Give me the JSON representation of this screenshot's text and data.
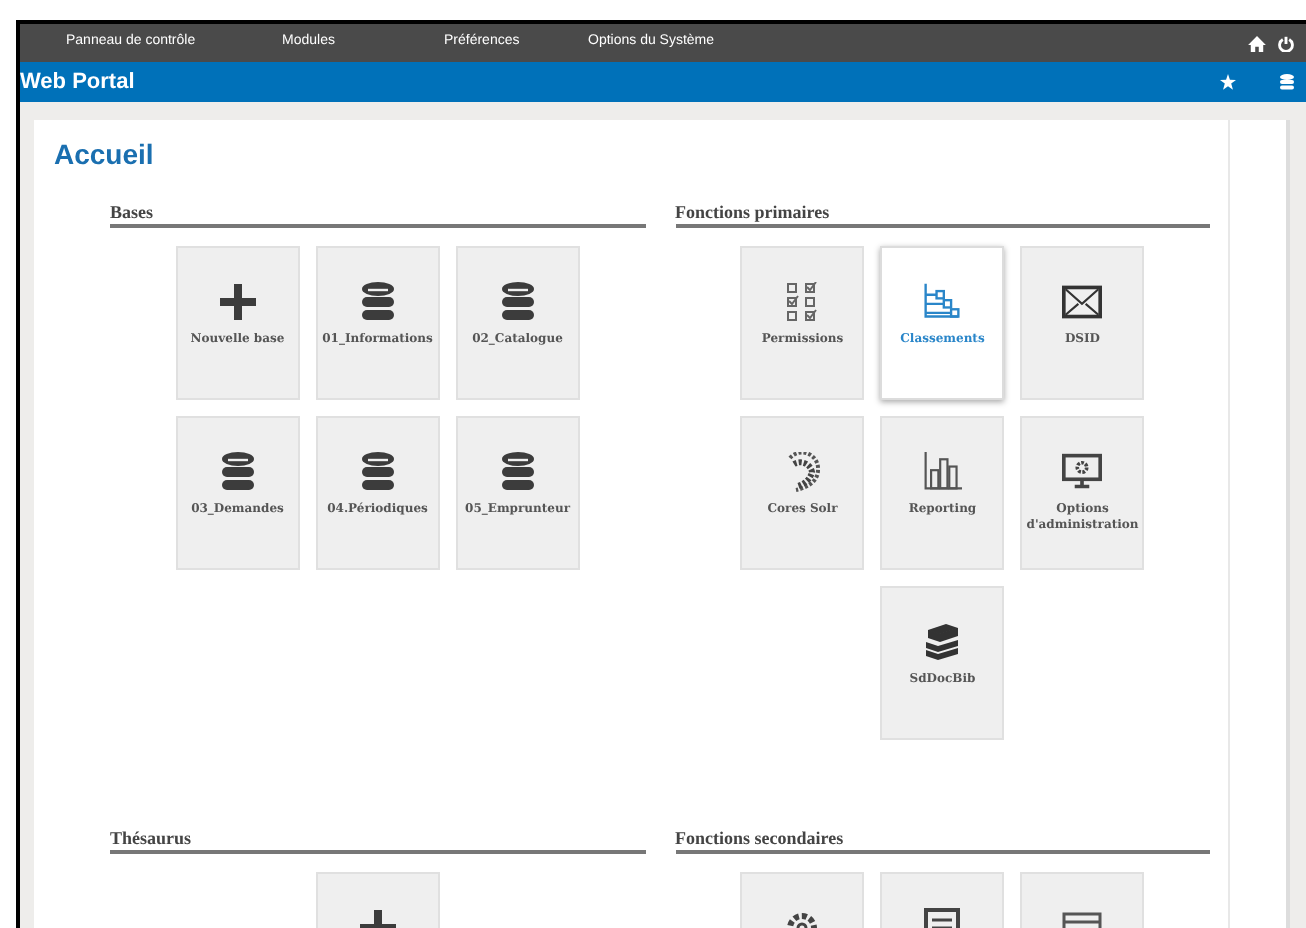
{
  "menu": [
    {
      "label": "Panneau de contrôle"
    },
    {
      "label": "Modules"
    },
    {
      "label": "Préférences"
    },
    {
      "label": "Options du Système"
    }
  ],
  "header": {
    "title": "Web Portal"
  },
  "page": {
    "title": "Accueil"
  },
  "sections": [
    {
      "title": "Bases",
      "tiles": [
        {
          "kind": "plus",
          "label": "Nouvelle base",
          "selected": false
        },
        {
          "kind": "database",
          "label": "01_Informations",
          "selected": false
        },
        {
          "kind": "database",
          "label": "02_Catalogue",
          "selected": false
        },
        {
          "kind": "database",
          "label": "03_Demandes",
          "selected": false
        },
        {
          "kind": "database",
          "label": "04.Périodiques",
          "selected": false
        },
        {
          "kind": "database",
          "label": "05_Emprunteur",
          "selected": false
        }
      ]
    },
    {
      "title": "Fonctions primaires",
      "tiles": [
        {
          "kind": "checklist",
          "label": "Permissions",
          "selected": false
        },
        {
          "kind": "tree",
          "label": "Classements",
          "selected": true
        },
        {
          "kind": "envelope",
          "label": "DSID",
          "selected": false
        },
        {
          "kind": "shell",
          "label": "Cores Solr",
          "selected": false
        },
        {
          "kind": "chart",
          "label": "Reporting",
          "selected": false
        },
        {
          "kind": "monitor",
          "label": "Options d'administration",
          "selected": false
        },
        {
          "kind": "books",
          "label": "SdDocBib",
          "selected": false
        }
      ]
    },
    {
      "title": "Thésaurus",
      "tiles": [
        {
          "kind": "plus",
          "selected": false
        }
      ]
    },
    {
      "title": "Fonctions secondaires",
      "tiles": [
        {
          "kind": "gear",
          "selected": false
        },
        {
          "kind": "document",
          "selected": false
        },
        {
          "kind": "window",
          "selected": false
        }
      ]
    }
  ]
}
